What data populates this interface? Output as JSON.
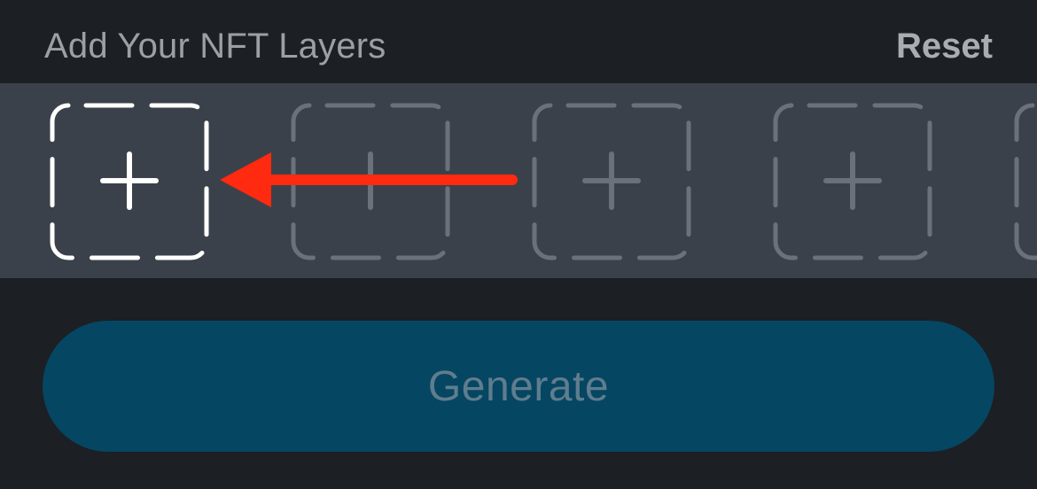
{
  "header": {
    "title": "Add Your NFT Layers",
    "reset_label": "Reset"
  },
  "layers": {
    "slots": [
      {
        "state": "active",
        "icon": "plus-icon"
      },
      {
        "state": "inactive",
        "icon": "plus-icon"
      },
      {
        "state": "inactive",
        "icon": "plus-icon"
      },
      {
        "state": "inactive",
        "icon": "plus-icon"
      },
      {
        "state": "inactive",
        "icon": "plus-icon"
      }
    ]
  },
  "annotation": {
    "arrow_color": "#ff2a0f",
    "arrow_icon": "left-arrow-icon"
  },
  "generate": {
    "label": "Generate"
  },
  "colors": {
    "background": "#1c1f23",
    "strip": "#3b414a",
    "slot_active": "#ffffff",
    "slot_inactive": "#6a717a",
    "button_bg": "#054663",
    "button_text": "#5f7d8d"
  }
}
